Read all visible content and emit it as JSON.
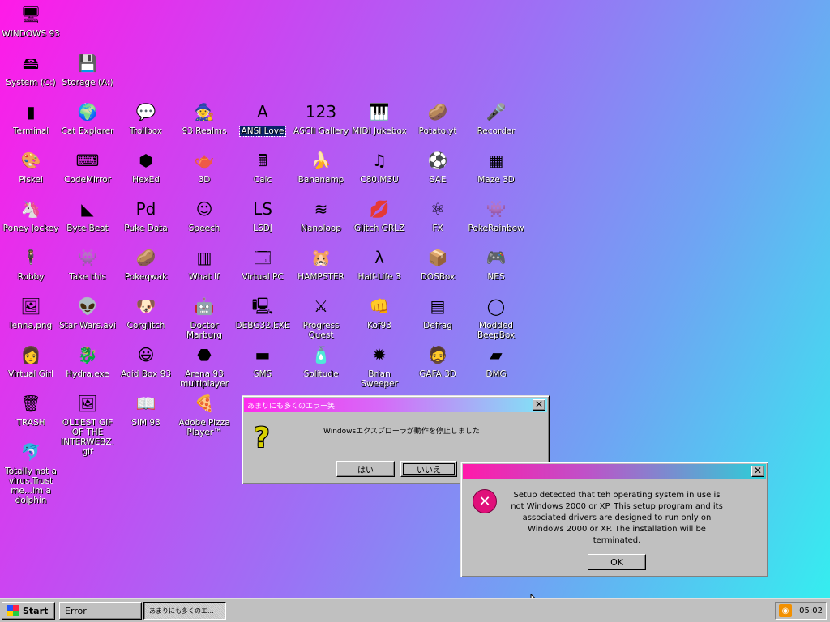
{
  "desktop": {
    "icons": [
      {
        "label": "WINDOWS 93",
        "glyph": "🖥",
        "icon": "computer-icon"
      },
      {
        "label": "System (C:)",
        "glyph": "🖴",
        "icon": "hard-drive-icon"
      },
      {
        "label": "Storage (A:)",
        "glyph": "💾",
        "icon": "floppy-drive-icon"
      },
      {
        "label": "Terminal",
        "glyph": "▮",
        "icon": "terminal-icon"
      },
      {
        "label": "Cat Explorer",
        "glyph": "🌍",
        "icon": "cat-globe-icon"
      },
      {
        "label": "Trollbox",
        "glyph": "💬",
        "icon": "chat-bubble-icon"
      },
      {
        "label": "93 Realms",
        "glyph": "🧙",
        "icon": "wizard-icon"
      },
      {
        "label": "ANSI Love",
        "glyph": "A",
        "icon": "ansi-letter-icon"
      },
      {
        "label": "ASCII Gallery",
        "glyph": "123",
        "icon": "ascii-numbers-icon"
      },
      {
        "label": "MIDI Jukebox",
        "glyph": "🎹",
        "icon": "piano-keys-icon"
      },
      {
        "label": "Potato.yt",
        "glyph": "🥔",
        "icon": "potato-icon"
      },
      {
        "label": "Recorder",
        "glyph": "🎤",
        "icon": "microphone-icon"
      },
      {
        "label": "Piskel",
        "glyph": "🎨",
        "icon": "palette-icon"
      },
      {
        "label": "CodeMirror",
        "glyph": "⌨",
        "icon": "code-editor-icon"
      },
      {
        "label": "HexEd",
        "glyph": "⬢",
        "icon": "hex-cube-icon"
      },
      {
        "label": "3D",
        "glyph": "🫖",
        "icon": "teapot-icon"
      },
      {
        "label": "Calc",
        "glyph": "🖩",
        "icon": "calculator-icon"
      },
      {
        "label": "Bananamp",
        "glyph": "🍌",
        "icon": "banana-icon"
      },
      {
        "label": "C80.M3U",
        "glyph": "♫",
        "icon": "music-file-icon"
      },
      {
        "label": "SAE",
        "glyph": "⚽",
        "icon": "checkered-ball-icon"
      },
      {
        "label": "Maze 3D",
        "glyph": "▦",
        "icon": "maze-icon"
      },
      {
        "label": "Poney Jockey",
        "glyph": "🦄",
        "icon": "pony-icon"
      },
      {
        "label": "Byte Beat",
        "glyph": "◣",
        "icon": "byte-beat-icon"
      },
      {
        "label": "Puke Data",
        "glyph": "Pd",
        "icon": "pure-data-icon"
      },
      {
        "label": "Speech",
        "glyph": "☺",
        "icon": "speech-face-icon"
      },
      {
        "label": "LSDJ",
        "glyph": "LS",
        "icon": "lsdj-icon"
      },
      {
        "label": "Nanoloop",
        "glyph": "≋",
        "icon": "nanoloop-wave-icon"
      },
      {
        "label": "Glitch GRLZ",
        "glyph": "💋",
        "icon": "lips-icon"
      },
      {
        "label": "FX",
        "glyph": "⚛",
        "icon": "atom-icon"
      },
      {
        "label": "PokeRainbow",
        "glyph": "👾",
        "icon": "pixel-characters-icon"
      },
      {
        "label": "Robby",
        "glyph": "🕴",
        "icon": "stick-figure-icon"
      },
      {
        "label": "Take this",
        "glyph": "👾",
        "icon": "pixel-robot-icon"
      },
      {
        "label": "Pokeqwak",
        "glyph": "🥔",
        "icon": "brown-blob-icon"
      },
      {
        "label": "What If",
        "glyph": "▥",
        "icon": "green-matrix-icon"
      },
      {
        "label": "Virtual PC",
        "glyph": "🗔",
        "icon": "window-pc-icon"
      },
      {
        "label": "HAMPSTER",
        "glyph": "🐹",
        "icon": "hamster-icon"
      },
      {
        "label": "Half-Life 3",
        "glyph": "λ",
        "icon": "lambda-icon"
      },
      {
        "label": "DOSBox",
        "glyph": "📦",
        "icon": "dosbox-icon"
      },
      {
        "label": "NES",
        "glyph": "🎮",
        "icon": "nes-console-icon"
      },
      {
        "label": "lenna.png",
        "glyph": "🖼",
        "icon": "image-file-icon"
      },
      {
        "label": "Star Wars.avi",
        "glyph": "👽",
        "icon": "yoda-icon"
      },
      {
        "label": "Corglitch",
        "glyph": "🐶",
        "icon": "corgi-icon"
      },
      {
        "label": "Doctor Marburg",
        "glyph": "🤖",
        "icon": "doctor-robot-icon"
      },
      {
        "label": "DEBG32.EXE",
        "glyph": "🖳",
        "icon": "debug-monitor-icon"
      },
      {
        "label": "Progress Quest",
        "glyph": "⚔",
        "icon": "crossed-swords-icon"
      },
      {
        "label": "Kof93",
        "glyph": "👊",
        "icon": "fighter-icon"
      },
      {
        "label": "Defrag",
        "glyph": "▤",
        "icon": "defrag-icon"
      },
      {
        "label": "Modded BeepBox",
        "glyph": "◯",
        "icon": "green-ring-icon"
      },
      {
        "label": "Virtual Girl",
        "glyph": "👩",
        "icon": "portrait-icon"
      },
      {
        "label": "Hydra.exe",
        "glyph": "🐉",
        "icon": "hydra-icon"
      },
      {
        "label": "Acid Box 93",
        "glyph": "😃",
        "icon": "smiley-icon"
      },
      {
        "label": "Arena 93 multiplayer",
        "glyph": "⬣",
        "icon": "cube-icon"
      },
      {
        "label": "SMS",
        "glyph": "▬",
        "icon": "sms-console-icon"
      },
      {
        "label": "Solitude",
        "glyph": "🧴",
        "icon": "bottle-icon"
      },
      {
        "label": "Brian Sweeper",
        "glyph": "✹",
        "icon": "mine-icon"
      },
      {
        "label": "GAFA 3D",
        "glyph": "🧔",
        "icon": "face-icon"
      },
      {
        "label": "DMG",
        "glyph": "▰",
        "icon": "gameboy-icon"
      },
      {
        "label": "TRASH",
        "glyph": "🗑",
        "icon": "trash-icon"
      },
      {
        "label": "OLDEST GIF OF THE INTERWEBZ.gif",
        "glyph": "🖼",
        "icon": "gif-file-icon"
      },
      {
        "label": "SIM 93",
        "glyph": "📖",
        "icon": "book-icon"
      },
      {
        "label": "Adobe Pizza Player™",
        "glyph": "🍕",
        "icon": "pizza-icon"
      },
      {
        "label": "Totally not a virus.Trust me...im a dolphin",
        "glyph": "🐬",
        "icon": "dolphin-icon"
      }
    ]
  },
  "dialog_jp": {
    "title": "あまりにも多くのエラー笑",
    "message": "Windowsエクスプローラが動作を停止しました",
    "yes_label": "はい",
    "no_label": "いいえ"
  },
  "dialog_error": {
    "message": "Setup detected that teh operating system in use is not Windows 2000 or XP. This setup program and its associated drivers are designed to run only on Windows 2000 or XP. The installation will be terminated.",
    "ok_label": "OK"
  },
  "taskbar": {
    "start_label": "Start",
    "tasks": [
      {
        "label": "Error"
      },
      {
        "label": "あまりにも多くのエ..."
      }
    ],
    "clock": "05:02"
  },
  "colors": {
    "bg_start": "#ff1ae8",
    "bg_end": "#33f0ef",
    "error_red": "#e0107a",
    "question_yellow": "#d8d000"
  }
}
